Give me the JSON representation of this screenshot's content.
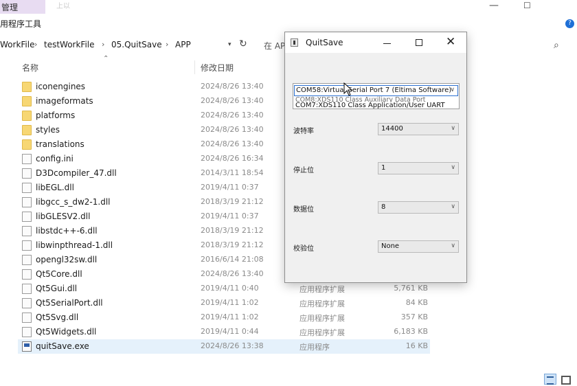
{
  "explorer": {
    "manage_tab": "管理",
    "title_ghost": "上以",
    "ribbon": "用程序工具",
    "breadcrumbs": [
      "WorkFile",
      "testWorkFile",
      "05.QuitSave",
      "APP"
    ],
    "search_ghost": "在 AP",
    "columns": {
      "name": "名称",
      "date": "修改日期"
    },
    "files": [
      {
        "name": "iconengines",
        "date": "2024/8/26 13:40",
        "type": "",
        "size": "",
        "kind": "folder"
      },
      {
        "name": "imageformats",
        "date": "2024/8/26 13:40",
        "type": "",
        "size": "",
        "kind": "folder"
      },
      {
        "name": "platforms",
        "date": "2024/8/26 13:40",
        "type": "",
        "size": "",
        "kind": "folder"
      },
      {
        "name": "styles",
        "date": "2024/8/26 13:40",
        "type": "",
        "size": "",
        "kind": "folder"
      },
      {
        "name": "translations",
        "date": "2024/8/26 13:40",
        "type": "",
        "size": "",
        "kind": "folder"
      },
      {
        "name": "config.ini",
        "date": "2024/8/26 16:34",
        "type": "",
        "size": "",
        "kind": "file"
      },
      {
        "name": "D3Dcompiler_47.dll",
        "date": "2014/3/11 18:54",
        "type": "",
        "size": "",
        "kind": "file"
      },
      {
        "name": "libEGL.dll",
        "date": "2019/4/11 0:37",
        "type": "",
        "size": "",
        "kind": "file"
      },
      {
        "name": "libgcc_s_dw2-1.dll",
        "date": "2018/3/19 21:12",
        "type": "",
        "size": "",
        "kind": "file"
      },
      {
        "name": "libGLESV2.dll",
        "date": "2019/4/11 0:37",
        "type": "",
        "size": "",
        "kind": "file"
      },
      {
        "name": "libstdc++-6.dll",
        "date": "2018/3/19 21:12",
        "type": "",
        "size": "",
        "kind": "file"
      },
      {
        "name": "libwinpthread-1.dll",
        "date": "2018/3/19 21:12",
        "type": "",
        "size": "",
        "kind": "file"
      },
      {
        "name": "opengl32sw.dll",
        "date": "2016/6/14 21:08",
        "type": "",
        "size": "",
        "kind": "file"
      },
      {
        "name": "Qt5Core.dll",
        "date": "2024/8/26 13:40",
        "type": "",
        "size": "",
        "kind": "file"
      },
      {
        "name": "Qt5Gui.dll",
        "date": "2019/4/11 0:40",
        "type": "应用程序扩展",
        "size": "5,761 KB",
        "kind": "file"
      },
      {
        "name": "Qt5SerialPort.dll",
        "date": "2019/4/11 1:02",
        "type": "应用程序扩展",
        "size": "84 KB",
        "kind": "file"
      },
      {
        "name": "Qt5Svg.dll",
        "date": "2019/4/11 1:02",
        "type": "应用程序扩展",
        "size": "357 KB",
        "kind": "file"
      },
      {
        "name": "Qt5Widgets.dll",
        "date": "2019/4/11 0:44",
        "type": "应用程序扩展",
        "size": "6,183 KB",
        "kind": "file"
      },
      {
        "name": "quitSave.exe",
        "date": "2024/8/26 13:38",
        "type": "应用程序",
        "size": "16 KB",
        "kind": "exe"
      }
    ]
  },
  "dialog": {
    "title": "QuitSave",
    "port_combo": {
      "selected": "COM58:Virtual Serial Port 7 (Eltima Software)",
      "ghost_item": "COM8:XDS110 Class Auxiliary Data Port",
      "item": "COM7:XDS110 Class Application/User UART"
    },
    "fields": [
      {
        "label": "波特率",
        "value": "14400"
      },
      {
        "label": "停止位",
        "value": "1"
      },
      {
        "label": "数据位",
        "value": "8"
      },
      {
        "label": "校验位",
        "value": "None"
      }
    ]
  },
  "icons": {
    "minimize": "minimize-icon",
    "maximize": "maximize-icon",
    "close": "close-icon",
    "refresh": "refresh-icon",
    "search": "search-icon",
    "folder": "folder-icon",
    "file": "file-icon"
  },
  "colors": {
    "selection": "#e5f1fb",
    "folder": "#f7d774",
    "manage_tab": "#e8dcf2",
    "focus_border": "#2a6fd0"
  }
}
